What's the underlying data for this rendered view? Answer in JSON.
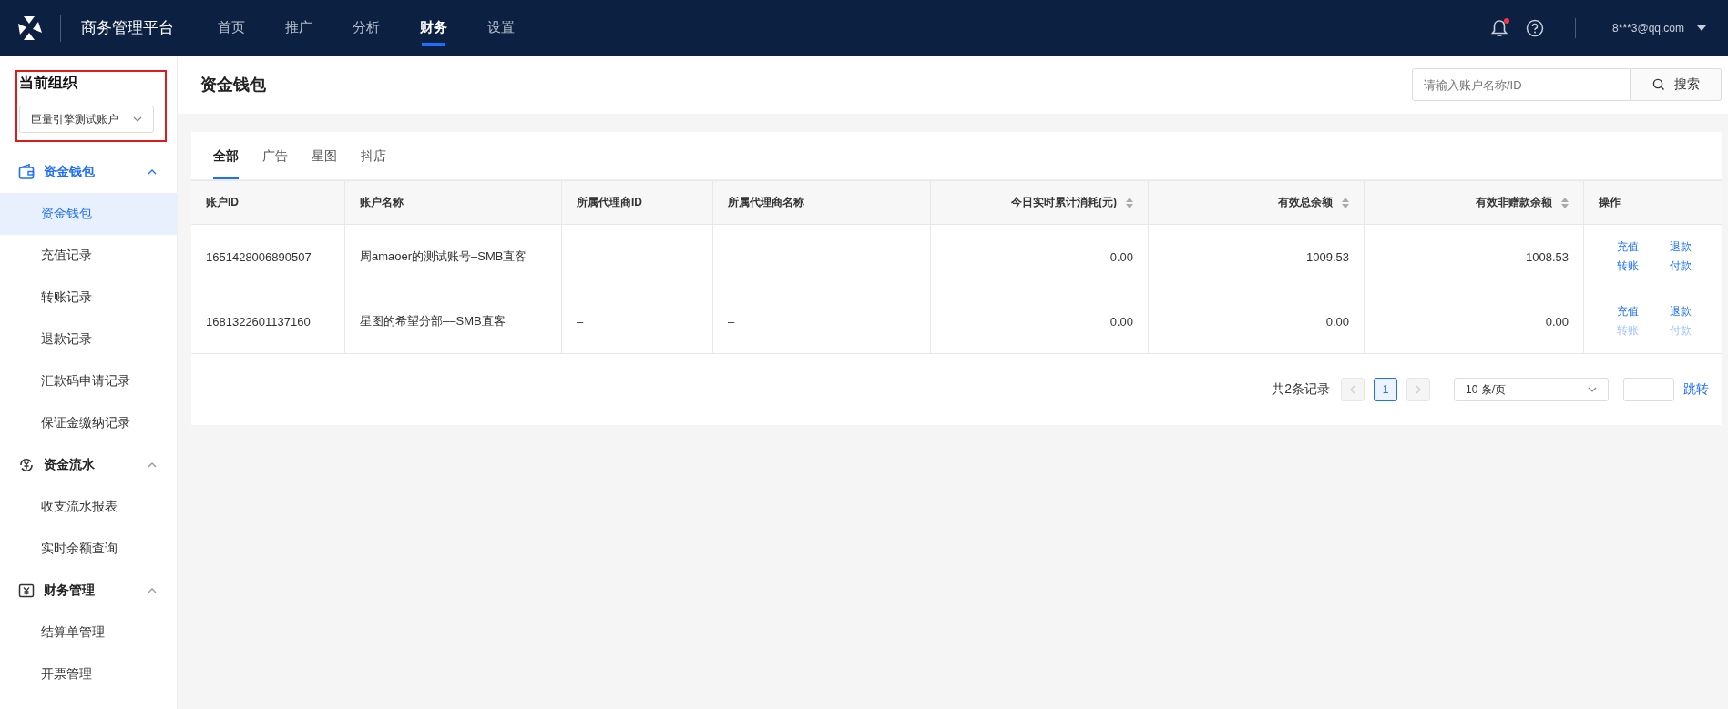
{
  "topbar": {
    "title": "商务管理平台",
    "nav": [
      {
        "label": "首页",
        "selected": false
      },
      {
        "label": "推广",
        "selected": false
      },
      {
        "label": "分析",
        "selected": false
      },
      {
        "label": "财务",
        "selected": true
      },
      {
        "label": "设置",
        "selected": false
      }
    ],
    "notifications_unread": true,
    "user": "8***3@qq.com"
  },
  "sidebar": {
    "org_label": "当前组织",
    "org_value": "巨量引擎测试账户",
    "org_highlighted": true,
    "groups": [
      {
        "label": "资金钱包",
        "active": true,
        "expanded": true,
        "children": [
          {
            "label": "资金钱包",
            "selected": true
          },
          {
            "label": "充值记录",
            "selected": false
          },
          {
            "label": "转账记录",
            "selected": false
          },
          {
            "label": "退款记录",
            "selected": false
          },
          {
            "label": "汇款码申请记录",
            "selected": false
          },
          {
            "label": "保证金缴纳记录",
            "selected": false
          }
        ]
      },
      {
        "label": "资金流水",
        "active": false,
        "expanded": true,
        "children": [
          {
            "label": "收支流水报表",
            "selected": false
          },
          {
            "label": "实时余额查询",
            "selected": false
          }
        ]
      },
      {
        "label": "财务管理",
        "active": false,
        "expanded": true,
        "children": [
          {
            "label": "结算单管理",
            "selected": false
          },
          {
            "label": "开票管理",
            "selected": false
          }
        ]
      }
    ]
  },
  "page": {
    "title": "资金钱包",
    "search": {
      "placeholder": "请输入账户名称/ID",
      "button": "搜索"
    }
  },
  "tabs": [
    {
      "label": "全部",
      "selected": true
    },
    {
      "label": "广告",
      "selected": false
    },
    {
      "label": "星图",
      "selected": false
    },
    {
      "label": "抖店",
      "selected": false
    }
  ],
  "table": {
    "columns": [
      {
        "label": "账户ID",
        "kind": "text",
        "sortable": false
      },
      {
        "label": "账户名称",
        "kind": "text",
        "sortable": false
      },
      {
        "label": "所属代理商ID",
        "kind": "text",
        "sortable": false
      },
      {
        "label": "所属代理商名称",
        "kind": "text",
        "sortable": false
      },
      {
        "label": "今日实时累计消耗(元)",
        "kind": "amount",
        "sortable": true
      },
      {
        "label": "有效总余额",
        "kind": "amount",
        "sortable": true
      },
      {
        "label": "有效非赠款余额",
        "kind": "amount",
        "sortable": true
      },
      {
        "label": "操作",
        "kind": "actions",
        "sortable": false
      }
    ],
    "rows": [
      {
        "cells": [
          "1651428006890507",
          "周amaoer的测试账号–SMB直客",
          "–",
          "–",
          "0.00",
          "1009.53",
          "1008.53"
        ],
        "actions": [
          {
            "label": "充值",
            "disabled": false
          },
          {
            "label": "退款",
            "disabled": false
          },
          {
            "label": "转账",
            "disabled": false
          },
          {
            "label": "付款",
            "disabled": false
          }
        ]
      },
      {
        "cells": [
          "1681322601137160",
          "星图的希望分部––SMB直客",
          "–",
          "–",
          "0.00",
          "0.00",
          "0.00"
        ],
        "actions": [
          {
            "label": "充值",
            "disabled": false
          },
          {
            "label": "退款",
            "disabled": false
          },
          {
            "label": "转账",
            "disabled": true
          },
          {
            "label": "付款",
            "disabled": true
          }
        ]
      }
    ]
  },
  "pagination": {
    "total": "共2条记录",
    "prev_disabled": true,
    "next_disabled": true,
    "pages": [
      {
        "label": "1",
        "selected": true
      }
    ],
    "page_size": "10 条/页",
    "jump": "跳转"
  }
}
